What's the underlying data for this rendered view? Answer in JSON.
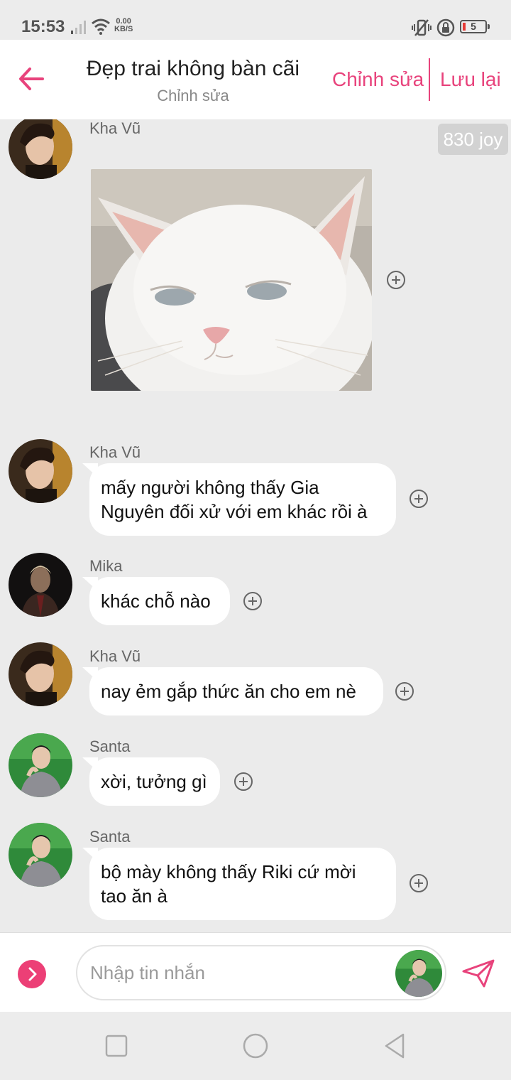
{
  "status_bar": {
    "time": "15:53",
    "net_speed_value": "0.00",
    "net_speed_unit": "KB/S",
    "battery": "5",
    "icons": [
      "signal-icon",
      "wifi-icon",
      "vibrate-icon",
      "rotation-lock-icon",
      "battery-icon"
    ]
  },
  "header": {
    "title": "Đẹp trai không bàn cãi",
    "subtitle": "Chỉnh sửa",
    "edit_label": "Chỉnh sửa",
    "save_label": "Lưu lại"
  },
  "joy_badge": "830 joy",
  "messages": [
    {
      "sender": "Kha Vũ",
      "type": "image",
      "image": "white cat meme"
    },
    {
      "sender": "Kha Vũ",
      "type": "text",
      "lines": [
        "mấy người không thấy Gia",
        "Nguyên đối xử với em khác rồi à"
      ]
    },
    {
      "sender": "Mika",
      "type": "text",
      "lines": [
        "khác chỗ nào"
      ]
    },
    {
      "sender": "Kha Vũ",
      "type": "text",
      "lines": [
        "nay ẻm gắp thức ăn cho em nè"
      ]
    },
    {
      "sender": "Santa",
      "type": "text",
      "lines": [
        "xời, tưởng gì"
      ]
    },
    {
      "sender": "Santa",
      "type": "text",
      "lines": [
        "bộ mày không thấy Riki cứ mời",
        "tao ăn à"
      ]
    }
  ],
  "input": {
    "placeholder": "Nhập tin nhắn"
  },
  "colors": {
    "accent": "#e8437c",
    "expand_button": "#ec3f76",
    "chat_background": "#ebebeb",
    "bubble": "#ffffff"
  }
}
